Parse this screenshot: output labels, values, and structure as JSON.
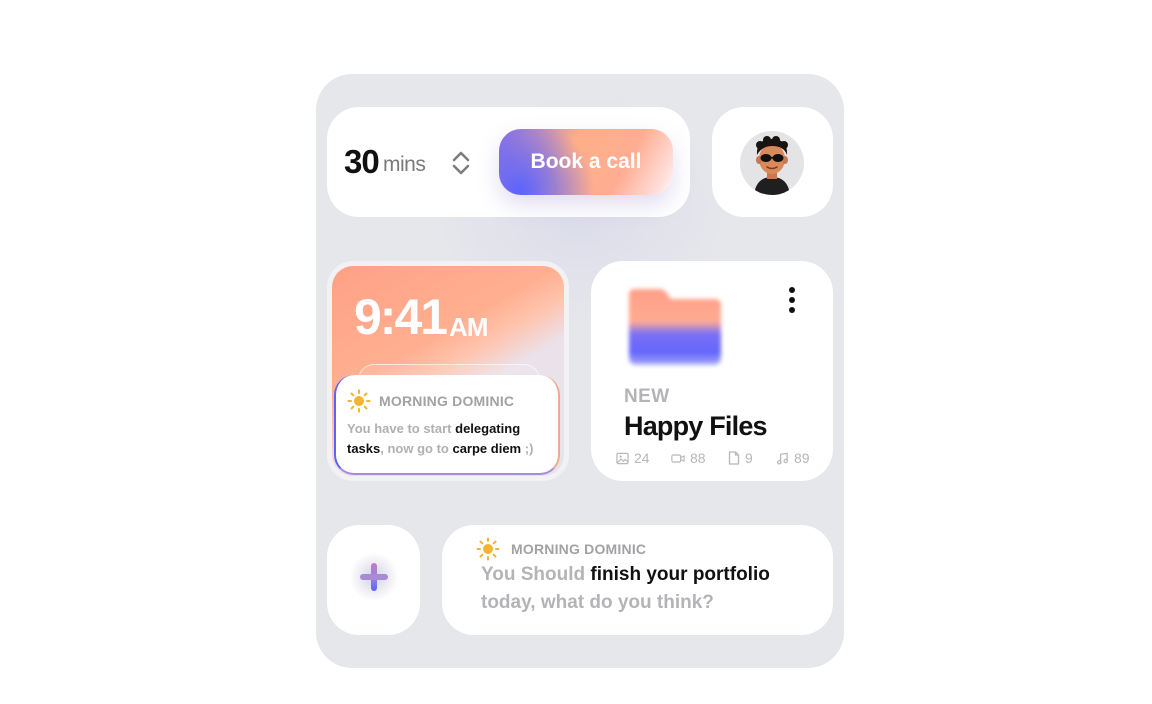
{
  "timer": {
    "value": "30",
    "unit": "mins",
    "book_label": "Book a call"
  },
  "avatar": {
    "icon": "user-avatar-icon"
  },
  "clock": {
    "time": "9:41",
    "ampm": "AM",
    "message": {
      "icon": "sun-icon",
      "title": "MORNING DOMINIC",
      "part1": "You have to start ",
      "highlight1": "delegating tasks",
      "part2": ", now go to ",
      "highlight2": "carpe diem",
      "part3": " ;)"
    }
  },
  "files": {
    "icon": "folder-icon",
    "badge": "NEW",
    "title": "Happy Files",
    "stats": [
      {
        "icon": "image-icon",
        "count": "24"
      },
      {
        "icon": "video-icon",
        "count": "88"
      },
      {
        "icon": "document-icon",
        "count": "9"
      },
      {
        "icon": "music-icon",
        "count": "89"
      }
    ]
  },
  "note": {
    "icon": "sun-icon",
    "title": "MORNING DOMINIC",
    "part1": "You Should ",
    "highlight": "finish your portfolio",
    "part2": " today, what do you think?"
  },
  "colors": {
    "panel": "#e6e7eb",
    "accent_blue": "#5b63ff",
    "accent_peach": "#ffad92",
    "sun": "#f5b330"
  }
}
